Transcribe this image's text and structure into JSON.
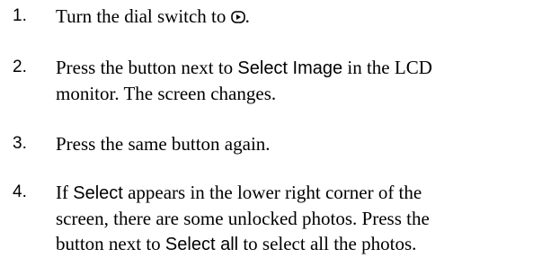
{
  "steps": [
    {
      "number": "1.",
      "before_icon": "Turn the dial switch to ",
      "icon": "playback-icon",
      "after_icon": "."
    },
    {
      "number": "2.",
      "part1": "Press the button next to ",
      "ui_term": "Select Image",
      "part2": " in the LCD",
      "line2": "monitor. The screen changes."
    },
    {
      "number": "3.",
      "text": "Press the same button again."
    },
    {
      "number": "4.",
      "part1": "If ",
      "ui_term1": "Select",
      "part2": " appears in the lower right corner of the",
      "line2": "screen, there are some unlocked photos. Press the",
      "line3_part1": "button next to ",
      "ui_term2": "Select all",
      "line3_part2": " to select all the photos."
    }
  ]
}
